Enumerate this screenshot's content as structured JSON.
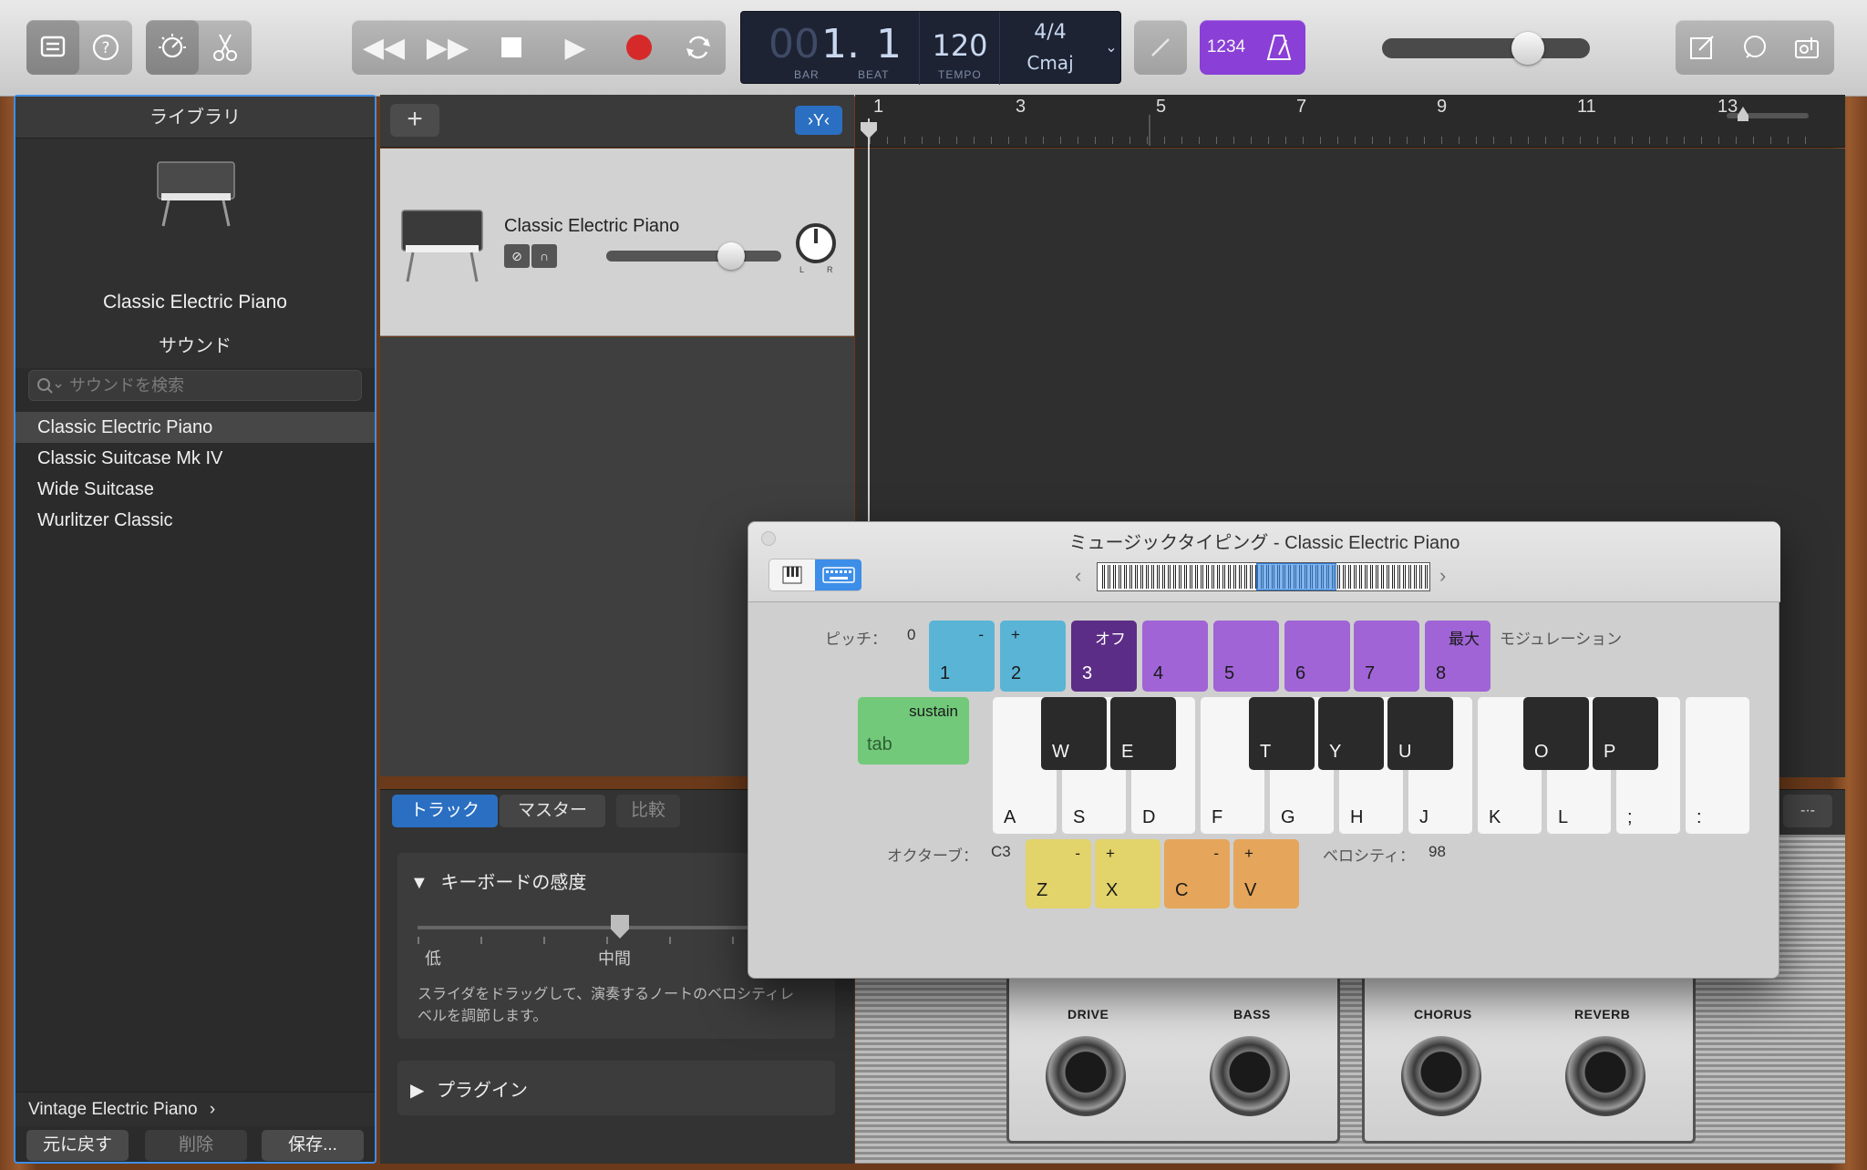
{
  "toolbar": {
    "lcd": {
      "bar_dim": "00",
      "bar": "1.",
      "beat": "1",
      "bar_label": "BAR",
      "beat_label": "BEAT",
      "tempo": "120",
      "tempo_label": "TEMPO",
      "signature": "4/4",
      "key": "Cmaj"
    },
    "count_in": "1234"
  },
  "library": {
    "title": "ライブラリ",
    "instrument_name": "Classic Electric Piano",
    "sound_header": "サウンド",
    "search_placeholder": "サウンドを検索",
    "sounds": [
      "Classic Electric Piano",
      "Classic Suitcase Mk IV",
      "Wide Suitcase",
      "Wurlitzer Classic"
    ],
    "footer_link": "Vintage Electric Piano",
    "footer_chevron": "›",
    "btn_revert": "元に戻す",
    "btn_delete": "削除",
    "btn_save": "保存..."
  },
  "track": {
    "name": "Classic Electric Piano",
    "pan_l": "L",
    "pan_r": "R"
  },
  "ruler": [
    "1",
    "3",
    "5",
    "7",
    "9",
    "11",
    "13"
  ],
  "smart_controls": {
    "tab_track": "トラック",
    "tab_master": "マスター",
    "tab_compare": "比較",
    "section_sensitivity": "キーボードの感度",
    "slider_low": "低",
    "slider_mid": "中間",
    "help_text_1": "スライダをドラッグして、演奏するノートのベロシティレ",
    "help_text_2": "ベルを調節します。",
    "section_plugins": "プラグイン",
    "knobs": [
      "DRIVE",
      "BASS",
      "CHORUS",
      "REVERB"
    ]
  },
  "music_typing": {
    "title": "ミュージックタイピング - Classic Electric Piano",
    "pitch_label": "ピッチ：",
    "pitch_value": "0",
    "modulation_label": "モジュレーション",
    "number_keys": [
      {
        "key": "1",
        "sub": "-"
      },
      {
        "key": "2",
        "sub": "+"
      },
      {
        "key": "3",
        "sub": "オフ"
      },
      {
        "key": "4",
        "sub": ""
      },
      {
        "key": "5",
        "sub": ""
      },
      {
        "key": "6",
        "sub": ""
      },
      {
        "key": "7",
        "sub": ""
      },
      {
        "key": "8",
        "sub": "最大"
      }
    ],
    "sustain_top": "sustain",
    "sustain_key": "tab",
    "white_keys": [
      "A",
      "S",
      "D",
      "F",
      "G",
      "H",
      "J",
      "K",
      "L",
      ";",
      ":"
    ],
    "black_keys": [
      "W",
      "E",
      "T",
      "Y",
      "U",
      "O",
      "P"
    ],
    "octave_label": "オクターブ：",
    "octave_value": "C3",
    "octave_keys": [
      {
        "key": "Z",
        "sub": "-"
      },
      {
        "key": "X",
        "sub": "+"
      }
    ],
    "velocity_keys": [
      {
        "key": "C",
        "sub": "-"
      },
      {
        "key": "V",
        "sub": "+"
      }
    ],
    "velocity_label": "ベロシティ：",
    "velocity_value": "98"
  },
  "colors": {
    "accent_blue": "#3d8ee8",
    "pitch_key": "#5ab4d6",
    "mod_off_key": "#5b2d86",
    "mod_key": "#a064d6",
    "sustain_key": "#72c97a",
    "octave_key": "#e2d36a",
    "velocity_key": "#e5a55a",
    "record_red": "#d62a2a",
    "count_in_purple": "#8a3fd6"
  }
}
